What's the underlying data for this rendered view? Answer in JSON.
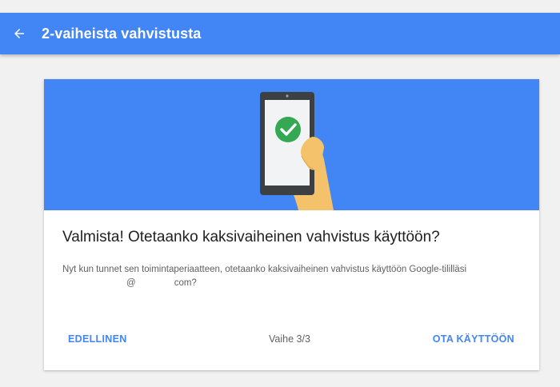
{
  "appbar": {
    "back_icon": "arrow-back-icon",
    "title": "2-vaiheista vahvistusta"
  },
  "card": {
    "illustration": "phone-check-icon",
    "heading": "Valmista! Otetaanko kaksivaiheinen vahvistus käyttöön?",
    "body_line1": "Nyt kun tunnet sen toimintaperiaatteen, otetaanko kaksivaiheinen vahvistus käyttöön Google-tililläsi",
    "body_at": "@",
    "body_domain": "com?",
    "buttons": {
      "previous": "EDELLINEN",
      "enable": "OTA KÄYTTÖÖN"
    },
    "step_label": "Vaihe 3/3"
  },
  "colors": {
    "primary": "#4285f4",
    "success": "#34a853",
    "hand": "#f4c26b",
    "phone": "#3c4043"
  }
}
